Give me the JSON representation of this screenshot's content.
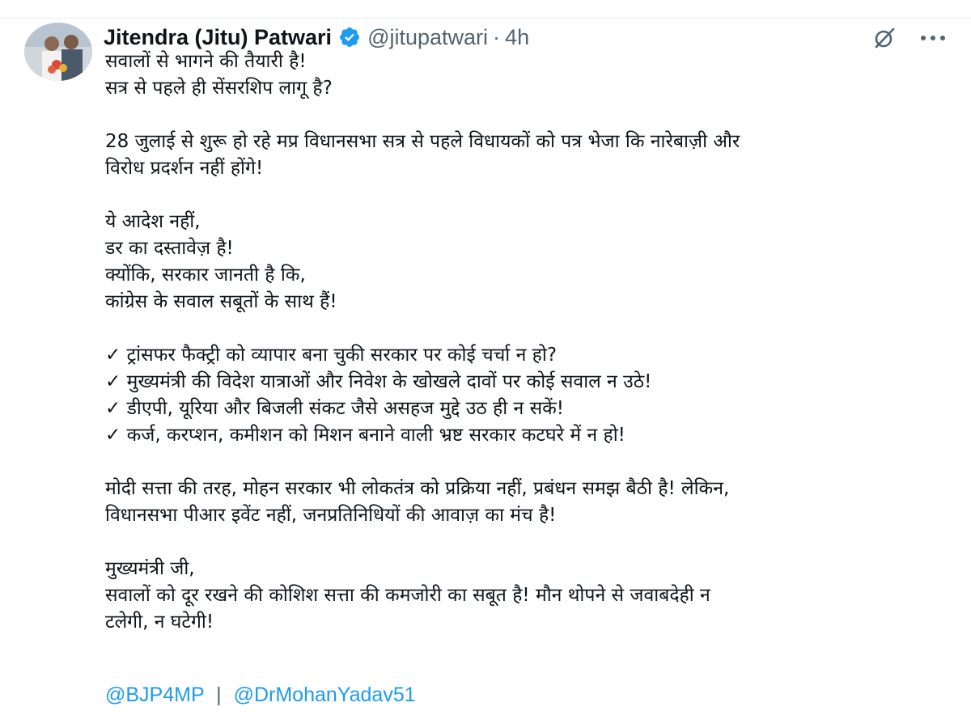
{
  "tweet": {
    "author": {
      "display_name": "Jitendra (Jitu) Patwari",
      "handle": "@jitupatwari",
      "separator": "·",
      "time": "4h",
      "verified_icon": "verified-badge-icon",
      "verified_color": "#1d9bf0"
    },
    "actions": {
      "grok_icon": "grok-icon",
      "more_icon": "more-options-icon",
      "more_glyph": "···"
    },
    "body_lines": [
      "सवालों से भागने की तैयारी है!",
      "सत्र से पहले ही सेंसरशिप लागू है?",
      "",
      "28 जुलाई से शुरू हो रहे मप्र विधानसभा सत्र से पहले विधायकों को पत्र भेजा कि नारेबाज़ी और",
      "विरोध प्रदर्शन नहीं होंगे!",
      "",
      "ये आदेश नहीं,",
      "डर का दस्तावेज़ है!",
      "क्योंकि, सरकार जानती है कि,",
      "कांग्रेस के सवाल सबूतों के साथ हैं!",
      "",
      "✓ ट्रांसफर फैक्ट्री को व्यापार बना चुकी सरकार पर कोई चर्चा न हो?",
      "✓ मुख्यमंत्री की विदेश यात्राओं और निवेश के खोखले दावों पर कोई सवाल न उठे!",
      "✓ डीएपी, यूरिया और बिजली संकट जैसे असहज मुद्दे उठ ही न सकें!",
      "✓ कर्ज, करप्शन, कमीशन को मिशन बनाने वाली भ्रष्ट सरकार कटघरे में न हो!",
      "",
      "मोदी सत्ता की तरह, मोहन सरकार भी लोकतंत्र को प्रक्रिया नहीं, प्रबंधन समझ बैठी है! लेकिन,",
      "विधानसभा पीआर इवेंट नहीं, जनप्रतिनिधियों की आवाज़ का मंच है!",
      "",
      "मुख्यमंत्री जी,",
      "सवालों को दूर रखने की कोशिश सत्ता की कमजोरी का सबूत है! मौन थोपने से जवाबदेही न",
      "टलेगी, न घटेगी!"
    ],
    "mentions": {
      "first": "@BJP4MP",
      "separator": "|",
      "second": "@DrMohanYadav51"
    },
    "colors": {
      "link": "#1d9bf0",
      "secondary_text": "#536471",
      "primary_text": "#0f1419"
    }
  }
}
